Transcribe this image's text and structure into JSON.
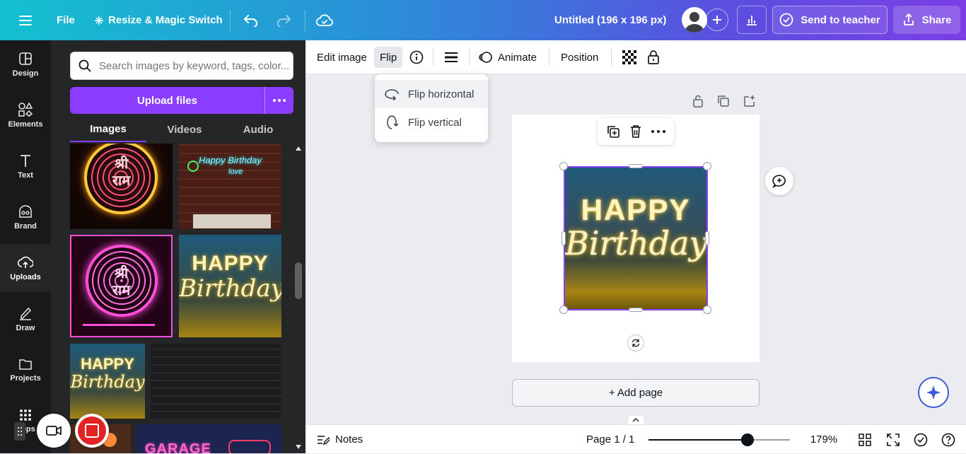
{
  "topbar": {
    "file": "File",
    "resize": "Resize & Magic Switch",
    "title": "Untitled (196 x 196 px)",
    "send": "Send to teacher",
    "share": "Share"
  },
  "rail": {
    "items": [
      {
        "label": "Design"
      },
      {
        "label": "Elements"
      },
      {
        "label": "Text"
      },
      {
        "label": "Brand"
      },
      {
        "label": "Uploads"
      },
      {
        "label": "Draw"
      },
      {
        "label": "Projects"
      },
      {
        "label": "Apps"
      }
    ]
  },
  "panel": {
    "search_placeholder": "Search images by keyword, tags, color...",
    "upload_label": "Upload files",
    "tabs": [
      {
        "label": "Images"
      },
      {
        "label": "Videos"
      },
      {
        "label": "Audio"
      }
    ]
  },
  "thumbs": {
    "shri_ram": "श्री\nराम",
    "birthday_top": "HAPPY",
    "birthday_bottom": "Birthday",
    "green_top": "Happy Birthday",
    "green_bottom": "love",
    "garage": "GARAGE"
  },
  "context": {
    "edit_image": "Edit image",
    "flip": "Flip",
    "animate": "Animate",
    "position": "Position"
  },
  "flip_menu": {
    "horizontal": "Flip horizontal",
    "vertical": "Flip vertical"
  },
  "canvas": {
    "image_top": "HAPPY",
    "image_bottom": "Birthday",
    "add_page": "+ Add page"
  },
  "bottombar": {
    "notes": "Notes",
    "page": "Page 1 / 1",
    "zoom": "179%",
    "zoom_level": 0.7
  },
  "colors": {
    "accent": "#8b3dff",
    "neon_gold": "#f5d76e",
    "neon_pink": "#ff4fd8"
  }
}
